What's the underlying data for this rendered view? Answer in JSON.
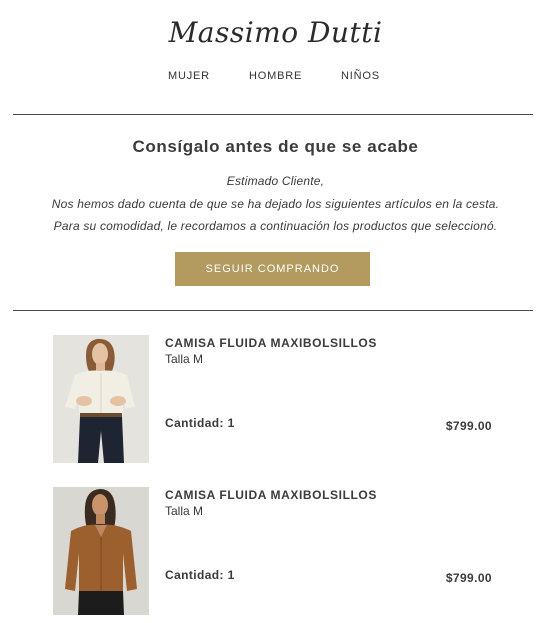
{
  "brand": {
    "logo_text": "Massimo Dutti"
  },
  "nav": {
    "items": [
      {
        "label": "MUJER"
      },
      {
        "label": "HOMBRE"
      },
      {
        "label": "NIÑOS"
      }
    ]
  },
  "message": {
    "title": "Consígalo antes de que se acabe",
    "greeting": "Estimado Cliente,",
    "line1": "Nos hemos dado cuenta de que se ha dejado los siguientes artículos en la cesta.",
    "line2": "Para su comodidad, le recordamos a continuación los productos que seleccionó.",
    "cta_label": "SEGUIR COMPRANDO",
    "cta_color": "#b39a5e"
  },
  "products": [
    {
      "name": "CAMISA FLUIDA MAXIBOLSILLOS",
      "size": "Talla M",
      "quantity": "Cantidad: 1",
      "price": "$799.00",
      "shirt_color": "#f1eee4",
      "pants_color": "#1f2433",
      "background_color": "#e5e3de"
    },
    {
      "name": "CAMISA FLUIDA MAXIBOLSILLOS",
      "size": "Talla M",
      "quantity": "Cantidad: 1",
      "price": "$799.00",
      "shirt_color": "#9c5f2e",
      "pants_color": "#1c1c1c",
      "background_color": "#d9d7d2"
    }
  ]
}
